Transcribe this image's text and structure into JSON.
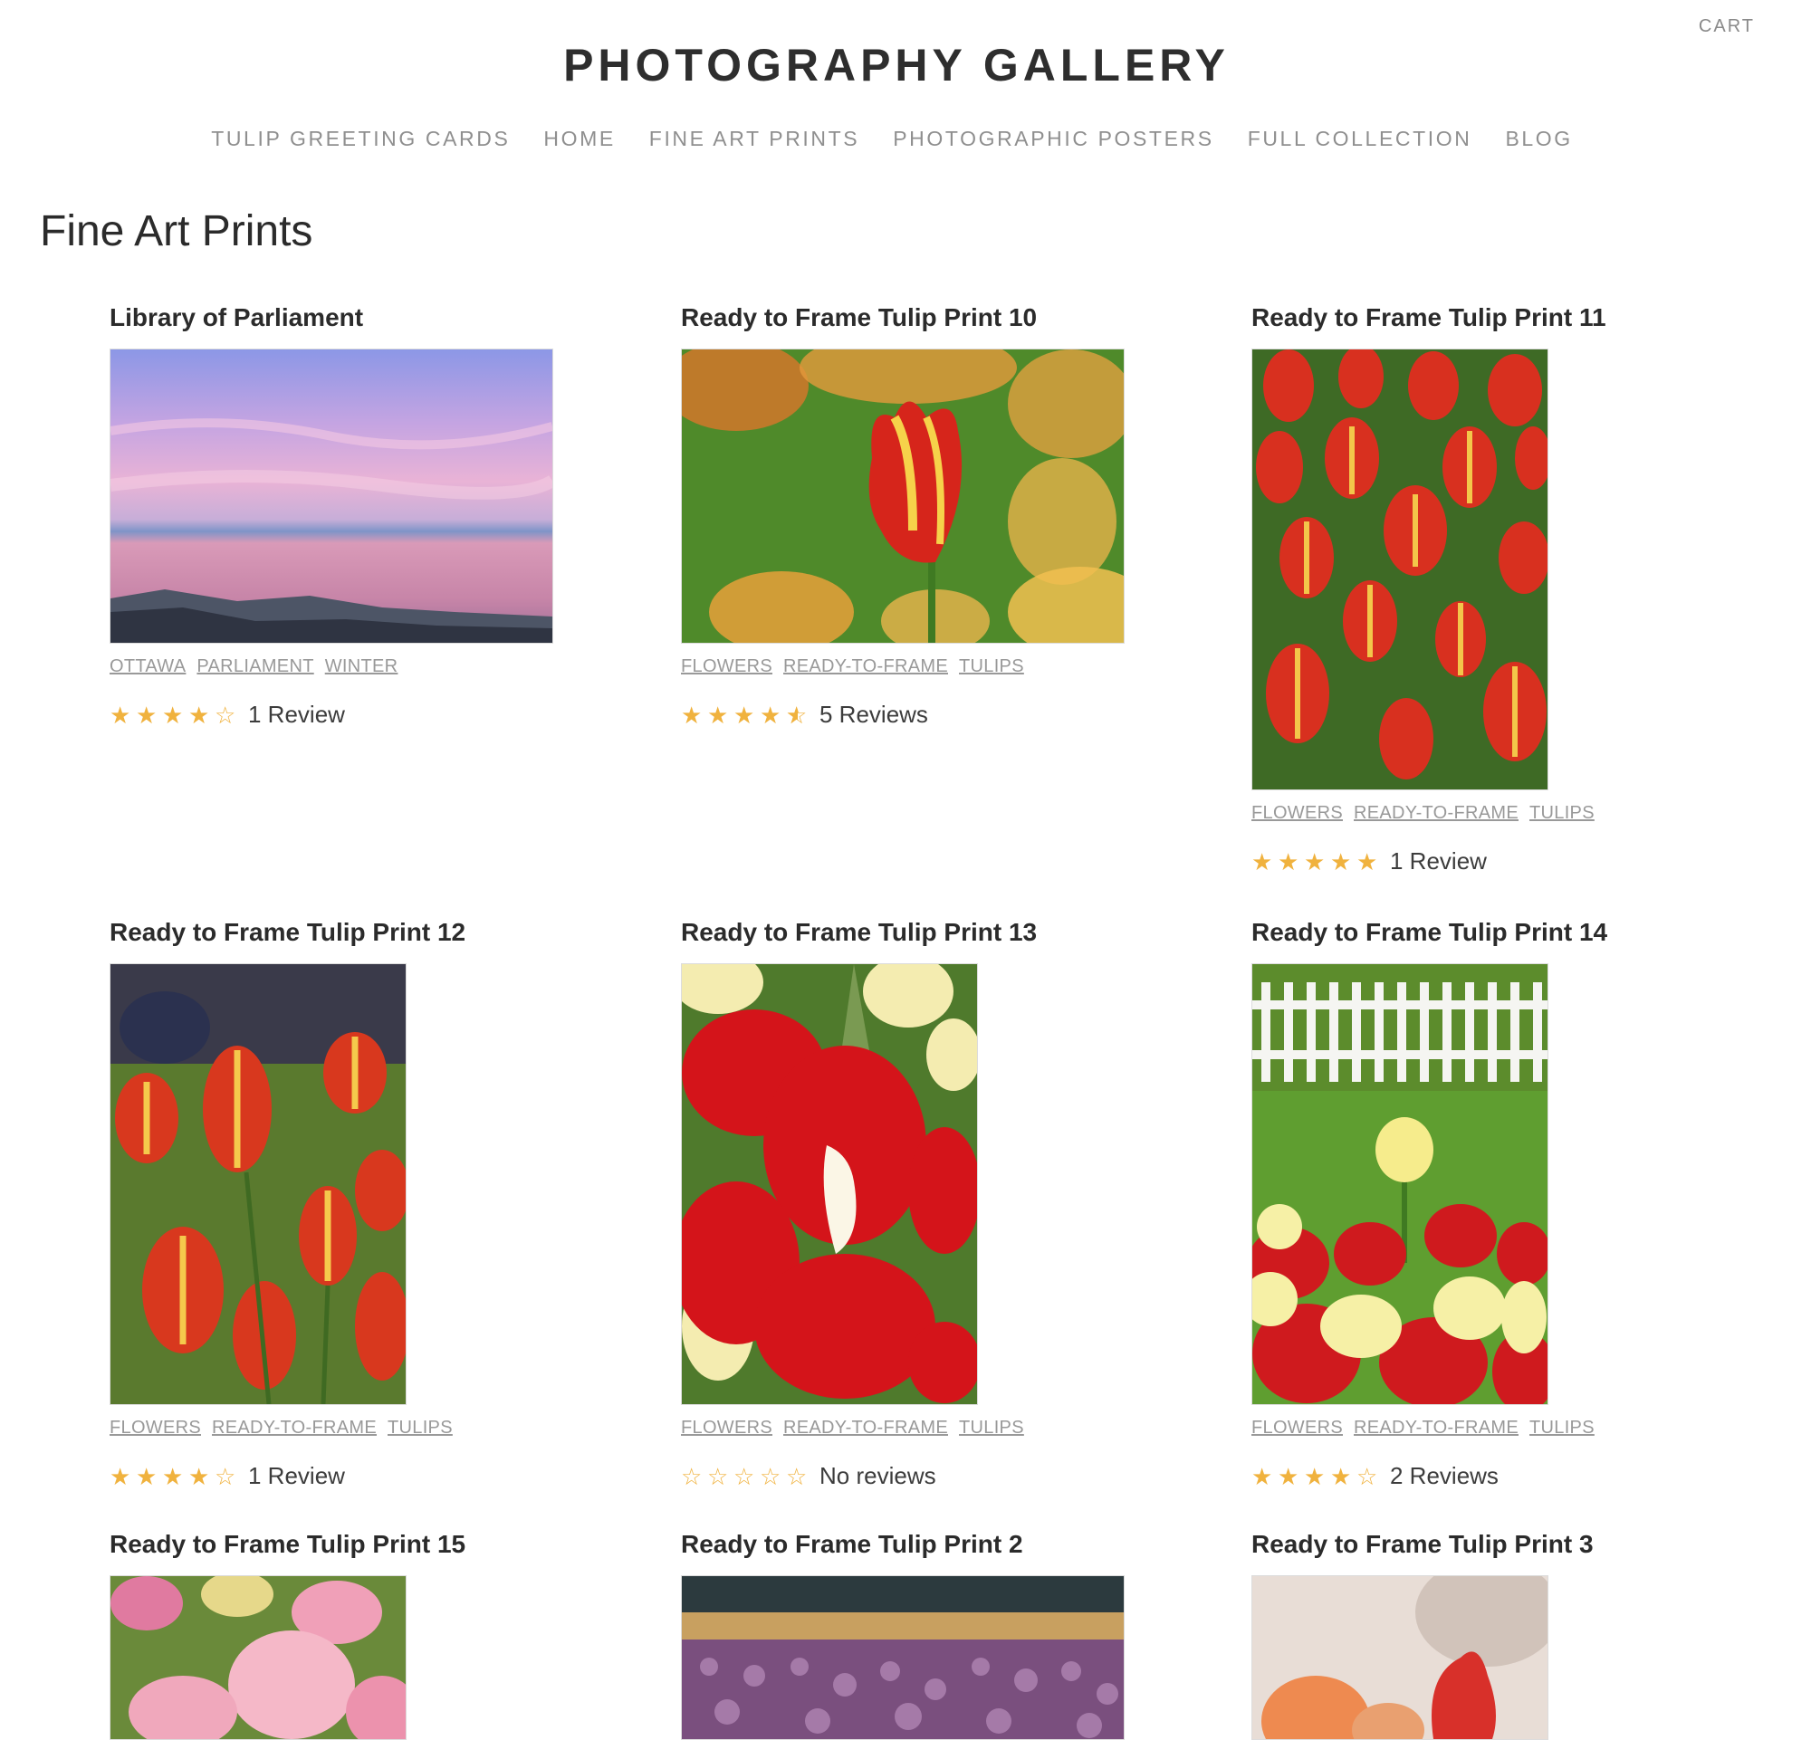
{
  "header": {
    "cart": "CART",
    "title": "PHOTOGRAPHY GALLERY",
    "nav": [
      "TULIP GREETING CARDS",
      "HOME",
      "FINE ART PRINTS",
      "PHOTOGRAPHIC POSTERS",
      "FULL COLLECTION",
      "BLOG"
    ]
  },
  "page": {
    "title": "Fine Art Prints"
  },
  "products": [
    {
      "title": "Library of Parliament",
      "tags": [
        "OTTAWA",
        "PARLIAMENT",
        "WINTER"
      ],
      "rating": 4,
      "reviews": "1 Review",
      "photo": "pink-sky-lake"
    },
    {
      "title": "Ready to Frame Tulip Print 10",
      "tags": [
        "FLOWERS",
        "READY-TO-FRAME",
        "TULIPS"
      ],
      "rating": 4.5,
      "reviews": "5 Reviews",
      "photo": "red-yellow-tulip"
    },
    {
      "title": "Ready to Frame Tulip Print 11",
      "tags": [
        "FLOWERS",
        "READY-TO-FRAME",
        "TULIPS"
      ],
      "rating": 5,
      "reviews": "1 Review",
      "photo": "tulip-field"
    },
    {
      "title": "Ready to Frame Tulip Print 12",
      "tags": [
        "FLOWERS",
        "READY-TO-FRAME",
        "TULIPS"
      ],
      "rating": 4,
      "reviews": "1 Review",
      "photo": "tulip-cluster"
    },
    {
      "title": "Ready to Frame Tulip Print 13",
      "tags": [
        "FLOWERS",
        "READY-TO-FRAME",
        "TULIPS"
      ],
      "rating": 0,
      "reviews": "No reviews",
      "photo": "red-white-tulip"
    },
    {
      "title": "Ready to Frame Tulip Print 14",
      "tags": [
        "FLOWERS",
        "READY-TO-FRAME",
        "TULIPS"
      ],
      "rating": 4,
      "reviews": "2 Reviews",
      "photo": "fence-tulips"
    },
    {
      "title": "Ready to Frame Tulip Print 15",
      "tags": [],
      "rating": null,
      "reviews": "",
      "photo": "pink-tulips"
    },
    {
      "title": "Ready to Frame Tulip Print 2",
      "tags": [],
      "rating": null,
      "reviews": "",
      "photo": "purple-field"
    },
    {
      "title": "Ready to Frame Tulip Print 3",
      "tags": [],
      "rating": null,
      "reviews": "",
      "photo": "orange-red-tulips"
    }
  ]
}
